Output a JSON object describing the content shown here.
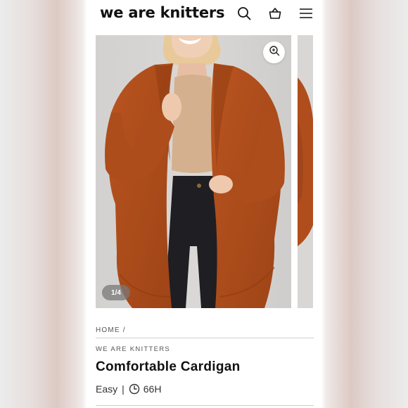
{
  "header": {
    "logo": "we are knitters",
    "icons": [
      "search-icon",
      "basket-icon",
      "menu-icon"
    ]
  },
  "gallery": {
    "counter": "1/4",
    "zoom_icon": "zoom-in-icon"
  },
  "breadcrumb": "HOME /",
  "product": {
    "brand": "WE ARE KNITTERS",
    "title": "Comfortable Cardigan",
    "difficulty": "Easy",
    "separator": "|",
    "duration": "66H"
  },
  "colors": {
    "sweater": "#b24f1f",
    "crop_top": "#d5b08e",
    "jeans": "#1f1e22",
    "backdrop": "#d7d5d3"
  }
}
